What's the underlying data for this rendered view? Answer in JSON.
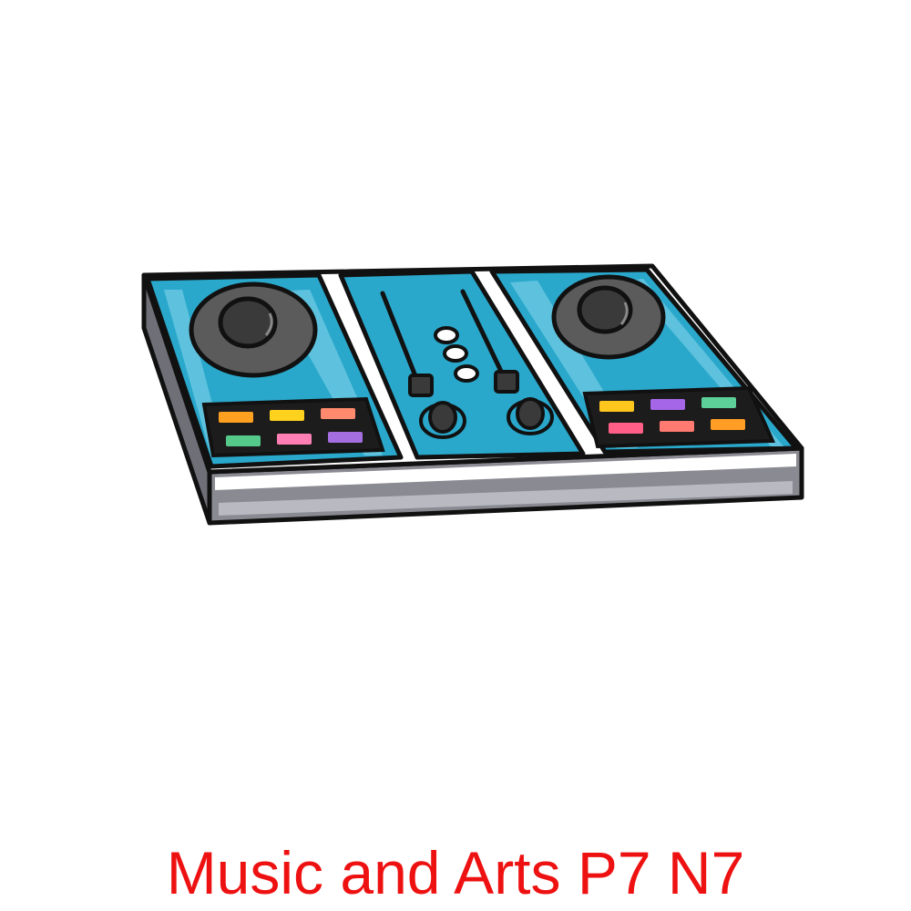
{
  "caption": {
    "text": "Music and Arts P7 N7",
    "color": "#ee1111"
  },
  "illustration": {
    "subject": "dj-controller",
    "icon": "dj-controller-icon",
    "colors": {
      "outline": "#111111",
      "deck_blue": "#2aa8cc",
      "deck_blue_light": "#6cc8e2",
      "rail_white": "#ffffff",
      "base_gray": "#8a8a92",
      "base_gray_light": "#b9b9c2",
      "platter_dark": "#3a3a3a",
      "platter_mid": "#5b5b5b",
      "pad_panel": "#1c1c1c"
    },
    "left_pads": [
      "#ffa020",
      "#ffd21e",
      "#ff8a6e",
      "#55c98a",
      "#ff7fb4",
      "#a46ee0"
    ],
    "right_pads": [
      "#ffc61e",
      "#a566e8",
      "#5dd09a",
      "#ff5e86",
      "#ff7a70",
      "#ff9d24"
    ]
  }
}
